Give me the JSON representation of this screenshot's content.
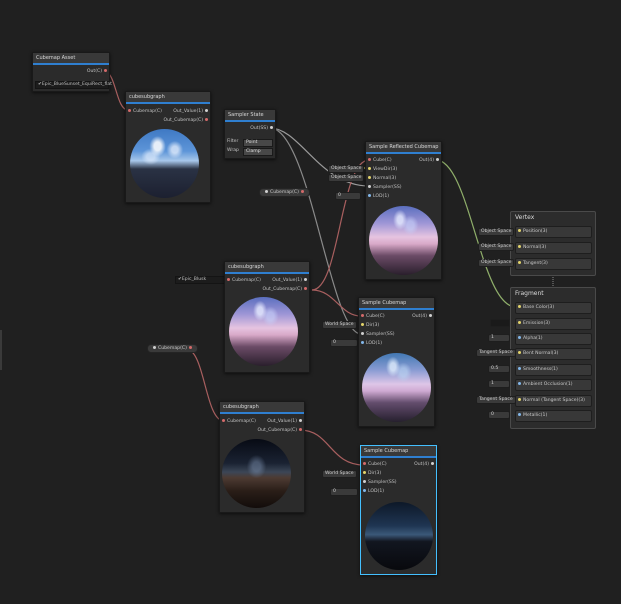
{
  "nodes": {
    "cubemap_asset": {
      "title": "Cubemap Asset",
      "out_port": "Out(C)",
      "asset_value": "Epic_BlueSunset_EquiRect_flat"
    },
    "cubesubgraph_1": {
      "title": "cubesubgraph",
      "in_port": "Cubemap(C)",
      "out_value": "Out_Value(1)",
      "out_cubemap": "Out_Cubemap(C)"
    },
    "sampler_state": {
      "title": "Sampler State",
      "out_port": "Out(SS)",
      "filter_label": "Filter",
      "filter_value": "Point",
      "wrap_label": "Wrap",
      "wrap_value": "Clamp"
    },
    "sample_reflected": {
      "title": "Sample Reflected Cubemap",
      "ports": [
        "Cube(C)",
        "ViewDir(3)",
        "Normal(3)",
        "Sampler(SS)",
        "LOD(1)"
      ],
      "out_port": "Out(4)"
    },
    "cubesubgraph_2": {
      "title": "cubesubgraph",
      "in_port": "Cubemap(C)",
      "out_value": "Out_Value(1)",
      "out_cubemap": "Out_Cubemap(C)"
    },
    "sample_cubemap_1": {
      "title": "Sample Cubemap",
      "ports": [
        "Cube(C)",
        "Dir(3)",
        "Sampler(SS)",
        "LOD(1)"
      ],
      "out_port": "Out(4)"
    },
    "cubesubgraph_3": {
      "title": "cubesubgraph",
      "in_port": "Cubemap(C)",
      "out_value": "Out_Value(1)",
      "out_cubemap": "Out_Cubemap(C)"
    },
    "sample_cubemap_2": {
      "title": "Sample Cubemap",
      "ports": [
        "Cube(C)",
        "Dir(3)",
        "Sampler(SS)",
        "LOD(1)"
      ],
      "out_port": "Out(4)"
    }
  },
  "properties": {
    "cubemap_prop_1": "Cubemap(C)",
    "cubemap_prop_2": "Cubemap(C)",
    "inline_asset": "Epic_Blusk"
  },
  "inline_params": {
    "object_space_1": "Object Space",
    "object_space_2": "Object Space",
    "lod_reflected": "0",
    "world_space_1": "World Space",
    "lod_1": "0",
    "world_space_2": "World Space",
    "lod_2": "0"
  },
  "vertex": {
    "title": "Vertex",
    "blocks": [
      {
        "param": "Object Space",
        "label": "Position(3)"
      },
      {
        "param": "Object Space",
        "label": "Normal(3)"
      },
      {
        "param": "Object Space",
        "label": "Tangent(3)"
      }
    ]
  },
  "fragment": {
    "title": "Fragment",
    "blocks": [
      {
        "param": "",
        "label": "Base Color(3)"
      },
      {
        "param": "",
        "label": "Emission(3)"
      },
      {
        "param": "1",
        "label": "Alpha(1)"
      },
      {
        "param": "Tangent Space",
        "label": "Bent Normal(3)"
      },
      {
        "param": "0.5",
        "label": "Smoothness(1)"
      },
      {
        "param": "1",
        "label": "Ambient Occlusion(1)"
      },
      {
        "param": "Tangent Space",
        "label": "Normal (Tangent Space)(3)"
      },
      {
        "param": "0",
        "label": "Metallic(1)"
      }
    ]
  },
  "colors": {
    "accent": "#2f7fd0",
    "selected": "#44c0ff",
    "cubemap_port": "#d46a6a",
    "vector3_port": "#e2d36b",
    "float_port": "#83b7e9"
  }
}
